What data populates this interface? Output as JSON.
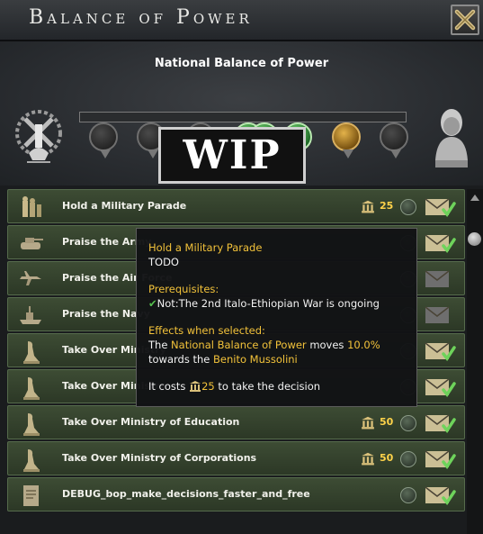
{
  "window": {
    "title": "Balance of Power",
    "close_icon": "close-x-icon"
  },
  "bop": {
    "title": "National Balance of Power",
    "left_side_icon": "fasces-eagle-emblem-icon",
    "right_side_icon": "leader-bust-icon",
    "slots": [
      {
        "state": "empty"
      },
      {
        "state": "empty"
      },
      {
        "state": "empty"
      },
      {
        "state": "green"
      },
      {
        "state": "green"
      },
      {
        "state": "green"
      },
      {
        "state": "gold"
      },
      {
        "state": "empty"
      }
    ],
    "wip_label": "WIP"
  },
  "decisions": [
    {
      "icon": "parade-soldiers-icon",
      "label": "Hold a Military Parade",
      "cost": "25",
      "has_cost": true
    },
    {
      "icon": "tank-icon",
      "label": "Praise the Army",
      "cost": "",
      "has_cost": false
    },
    {
      "icon": "airplane-icon",
      "label": "Praise the Air Force",
      "cost": "",
      "has_cost": false
    },
    {
      "icon": "warship-icon",
      "label": "Praise the Navy",
      "cost": "",
      "has_cost": false
    },
    {
      "icon": "ministry-statue-icon",
      "label": "Take Over Ministry",
      "cost": "",
      "has_cost": false
    },
    {
      "icon": "ministry-statue-icon",
      "label": "Take Over Ministry",
      "cost": "",
      "has_cost": false
    },
    {
      "icon": "ministry-statue-icon",
      "label": "Take Over Ministry of Education",
      "cost": "50",
      "has_cost": true
    },
    {
      "icon": "ministry-statue-icon",
      "label": "Take Over Ministry of Corporations",
      "cost": "50",
      "has_cost": true
    },
    {
      "icon": "document-icon",
      "label": "DEBUG_bop_make_decisions_faster_and_free",
      "cost": "",
      "has_cost": false
    }
  ],
  "tooltip": {
    "title": "Hold a Military Parade",
    "subtitle": "TODO",
    "prereq_header": "Prerequisites:",
    "prereq_prefix": "Not:",
    "prereq_text": "The 2nd Italo-Ethiopian War is ongoing",
    "effects_header": "Effects when selected:",
    "effect_the": "The",
    "effect_bop": "National Balance of Power",
    "effect_moves": "moves",
    "effect_amount": "10.0%",
    "effect_towards": "towards the",
    "effect_target": "Benito Mussolini",
    "cost_prefix": "It costs",
    "cost_value": "25",
    "cost_suffix": "to take the decision"
  },
  "colors": {
    "accent_gold": "#f2c23a",
    "row_green": "#3d4c34",
    "check_green": "#55c04e",
    "cost_yellow": "#ffd34a"
  }
}
